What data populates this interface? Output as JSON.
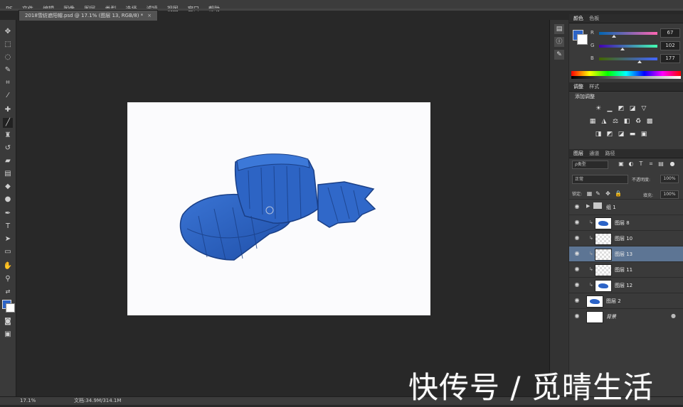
{
  "menubar": {
    "items": [
      "PS",
      "文件",
      "编辑",
      "图像",
      "图层",
      "类型",
      "选择",
      "滤镜",
      "视图",
      "窗口",
      "帮助"
    ]
  },
  "document_tab": {
    "title": "2018雪纺遮阳帽.psd @ 17.1% (图层 13, RGB/8) *",
    "close": "×"
  },
  "colors": {
    "foreground": "#2b63c7",
    "background": "#ffffff"
  },
  "color_panel": {
    "tabs": [
      "颜色",
      "色板"
    ],
    "sliders": [
      {
        "label": "R",
        "value": "67",
        "level": 0.26
      },
      {
        "label": "G",
        "value": "102",
        "level": 0.4
      },
      {
        "label": "B",
        "value": "177",
        "level": 0.69
      }
    ]
  },
  "adjustments_panel": {
    "tabs": [
      "调整",
      "样式"
    ],
    "title": "添加调整",
    "icons": [
      "brightness-icon",
      "levels-icon",
      "curves-icon",
      "exposure-icon",
      "triangle-icon",
      "vibrance-icon",
      "hue-saturation-icon",
      "color-balance-icon",
      "bw-icon",
      "photo-filter-icon",
      "channel-mixer-icon",
      "lookup-icon",
      "invert-icon",
      "posterize-icon",
      "threshold-icon",
      "gradient-map-icon",
      "selective-color-icon"
    ]
  },
  "layers_panel": {
    "tabs": [
      "图层",
      "通道",
      "路径"
    ],
    "filter": "ρ类型",
    "blend_mode": "正常",
    "opacity_label": "不透明度:",
    "opacity_value": "100%",
    "lock_label": "锁定:",
    "fill_label": "填充:",
    "fill_value": "100%",
    "layers": [
      {
        "name": "组 1",
        "type": "folder",
        "selected": false
      },
      {
        "name": "图层 8",
        "type": "layer",
        "thumb": "blue",
        "selected": false
      },
      {
        "name": "图层 10",
        "type": "layer",
        "thumb": "check",
        "selected": false
      },
      {
        "name": "图层 13",
        "type": "layer",
        "thumb": "check",
        "selected": true
      },
      {
        "name": "图层 11",
        "type": "layer",
        "thumb": "check",
        "selected": false
      },
      {
        "name": "图层 12",
        "type": "layer",
        "thumb": "blue",
        "selected": false
      },
      {
        "name": "图层 2",
        "type": "layer",
        "thumb": "blue",
        "selected": false
      },
      {
        "name": "背景",
        "type": "background",
        "thumb": "white",
        "selected": false
      }
    ]
  },
  "statusbar": {
    "zoom": "17.1%",
    "doc": "文档:34.9M/314.1M"
  },
  "watermark": {
    "text": "快传号 / 觅晴生活"
  }
}
